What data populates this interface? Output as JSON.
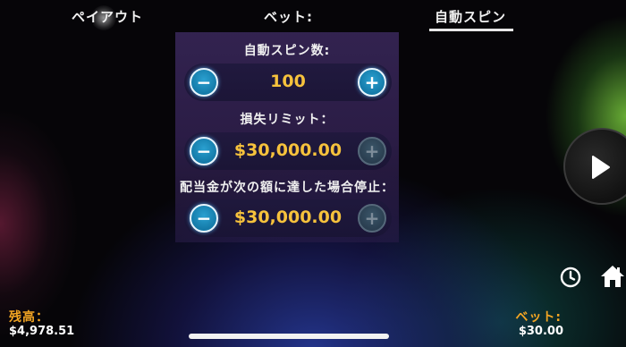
{
  "tabs": {
    "payout": "ペイアウト",
    "bet": "ベット:",
    "autospin": "自動スピン"
  },
  "autospin": {
    "spins_label": "自動スピン数:",
    "spins_value": "100",
    "loss_limit_label": "損失リミット：",
    "loss_limit_value": "$30,000.00",
    "win_stop_label": "配当金が次の額に達した場合停止：",
    "win_stop_value": "$30,000.00"
  },
  "buttons": {
    "minus": "−",
    "plus": "+"
  },
  "footer": {
    "balance_label": "残高：",
    "balance_value": "$4,978.51",
    "bet_label": "ベット:",
    "bet_value": "$30.00"
  },
  "icons": {
    "play": "play-icon",
    "history": "clock-icon",
    "home": "home-icon"
  },
  "colors": {
    "accent_value": "#f6c23c",
    "label_orange": "#f4a623",
    "button_active": "#1f8fc0"
  }
}
